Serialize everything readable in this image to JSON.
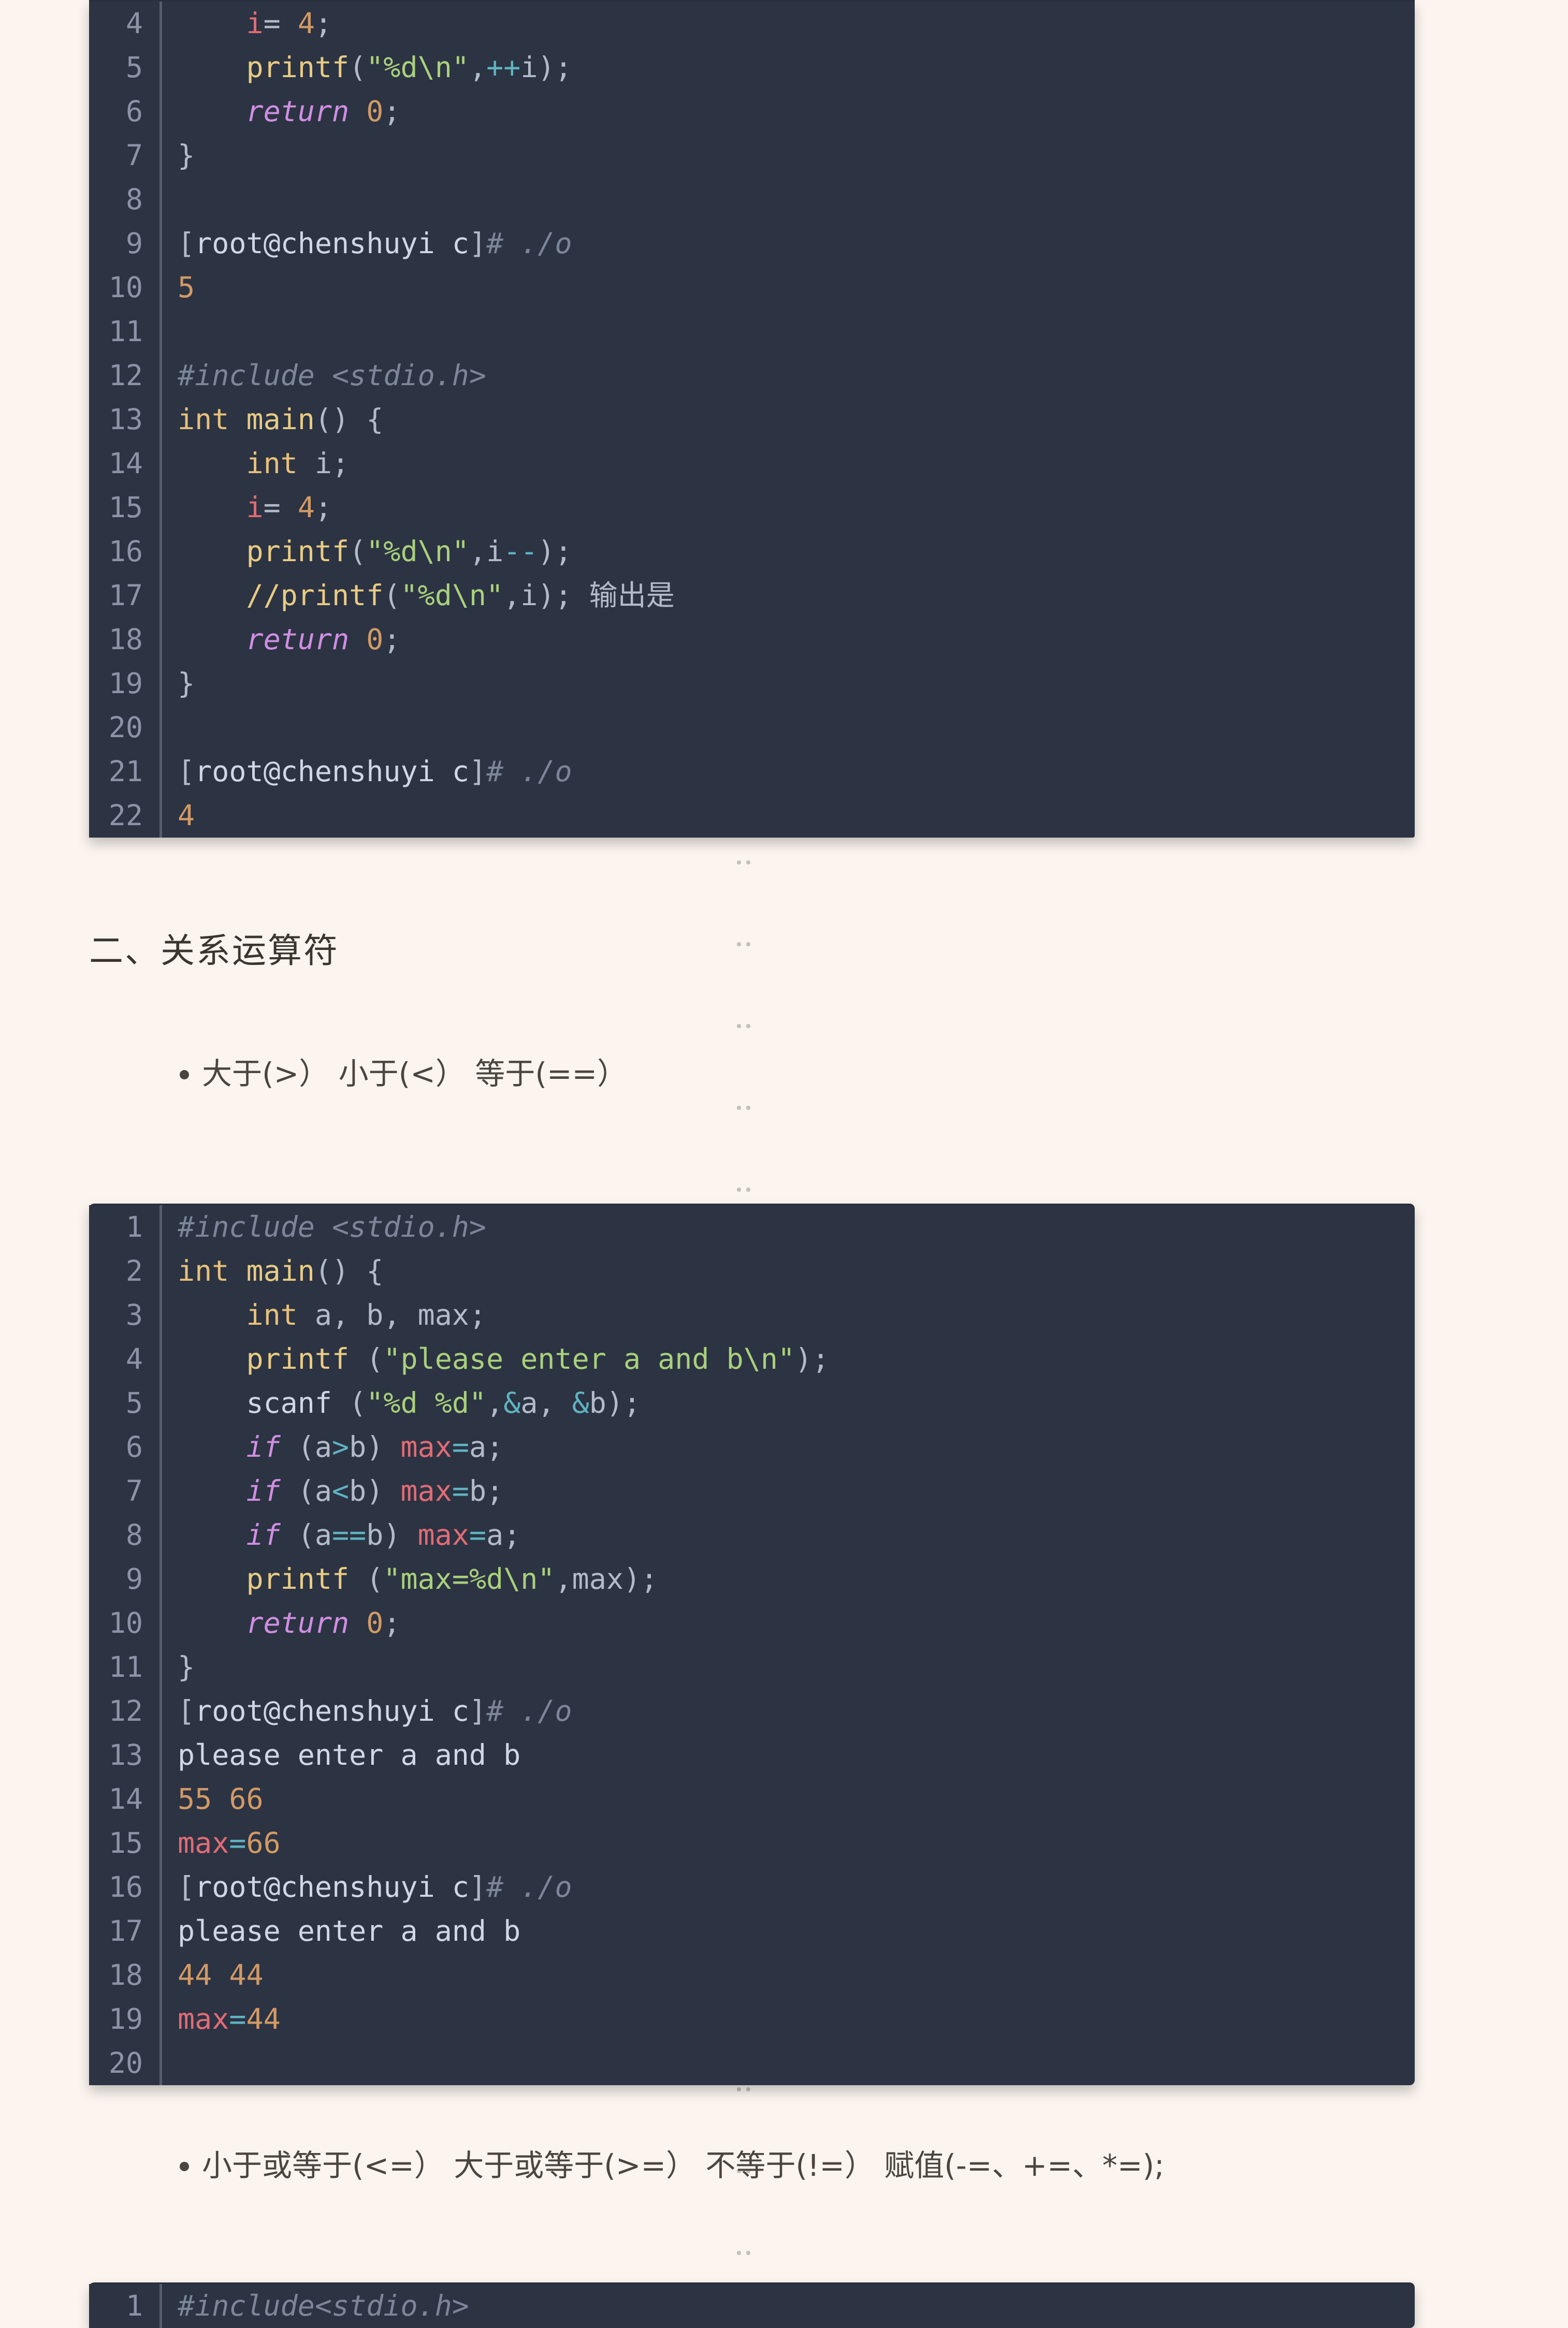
{
  "block1": {
    "lines": [
      {
        "n": "4",
        "tokens": [
          {
            "t": "    ",
            "c": "p"
          },
          {
            "t": "i",
            "c": "red"
          },
          {
            "t": "= ",
            "c": "p"
          },
          {
            "t": "4",
            "c": "num"
          },
          {
            "t": ";",
            "c": "p"
          }
        ]
      },
      {
        "n": "5",
        "tokens": [
          {
            "t": "    ",
            "c": "p"
          },
          {
            "t": "printf",
            "c": "fn"
          },
          {
            "t": "(",
            "c": "p"
          },
          {
            "t": "\"%d\\n\"",
            "c": "str"
          },
          {
            "t": ",",
            "c": "p"
          },
          {
            "t": "++",
            "c": "op"
          },
          {
            "t": "i);",
            "c": "p"
          }
        ]
      },
      {
        "n": "6",
        "tokens": [
          {
            "t": "    ",
            "c": "p"
          },
          {
            "t": "return",
            "c": "kw"
          },
          {
            "t": " ",
            "c": "p"
          },
          {
            "t": "0",
            "c": "num"
          },
          {
            "t": ";",
            "c": "p"
          }
        ]
      },
      {
        "n": "7",
        "tokens": [
          {
            "t": "}",
            "c": "p"
          }
        ]
      },
      {
        "n": "8",
        "tokens": [
          {
            "t": "",
            "c": "p"
          }
        ]
      },
      {
        "n": "9",
        "tokens": [
          {
            "t": "[",
            "c": "p"
          },
          {
            "t": "root@chenshuyi c",
            "c": "txt"
          },
          {
            "t": "]",
            "c": "p"
          },
          {
            "t": "# ./o",
            "c": "cmt"
          }
        ]
      },
      {
        "n": "10",
        "tokens": [
          {
            "t": "5",
            "c": "num"
          }
        ]
      },
      {
        "n": "11",
        "tokens": [
          {
            "t": "",
            "c": "p"
          }
        ]
      },
      {
        "n": "12",
        "tokens": [
          {
            "t": "#include <stdio.h>",
            "c": "cmt"
          }
        ]
      },
      {
        "n": "13",
        "tokens": [
          {
            "t": "int",
            "c": "ty"
          },
          {
            "t": " ",
            "c": "p"
          },
          {
            "t": "main",
            "c": "fn"
          },
          {
            "t": "() {",
            "c": "p"
          }
        ]
      },
      {
        "n": "14",
        "tokens": [
          {
            "t": "    ",
            "c": "p"
          },
          {
            "t": "int",
            "c": "ty"
          },
          {
            "t": " i;",
            "c": "p"
          }
        ]
      },
      {
        "n": "15",
        "tokens": [
          {
            "t": "    ",
            "c": "p"
          },
          {
            "t": "i",
            "c": "red"
          },
          {
            "t": "= ",
            "c": "p"
          },
          {
            "t": "4",
            "c": "num"
          },
          {
            "t": ";",
            "c": "p"
          }
        ]
      },
      {
        "n": "16",
        "tokens": [
          {
            "t": "    ",
            "c": "p"
          },
          {
            "t": "printf",
            "c": "fn"
          },
          {
            "t": "(",
            "c": "p"
          },
          {
            "t": "\"%d\\n\"",
            "c": "str"
          },
          {
            "t": ",i",
            "c": "p"
          },
          {
            "t": "--",
            "c": "op"
          },
          {
            "t": ");",
            "c": "p"
          }
        ]
      },
      {
        "n": "17",
        "tokens": [
          {
            "t": "    ",
            "c": "p"
          },
          {
            "t": "//printf",
            "c": "fn"
          },
          {
            "t": "(",
            "c": "p"
          },
          {
            "t": "\"%d\\n\"",
            "c": "str"
          },
          {
            "t": ",i); 输出是",
            "c": "p"
          }
        ]
      },
      {
        "n": "18",
        "tokens": [
          {
            "t": "    ",
            "c": "p"
          },
          {
            "t": "return",
            "c": "kw"
          },
          {
            "t": " ",
            "c": "p"
          },
          {
            "t": "0",
            "c": "num"
          },
          {
            "t": ";",
            "c": "p"
          }
        ]
      },
      {
        "n": "19",
        "tokens": [
          {
            "t": "}",
            "c": "p"
          }
        ]
      },
      {
        "n": "20",
        "tokens": [
          {
            "t": "",
            "c": "p"
          }
        ]
      },
      {
        "n": "21",
        "tokens": [
          {
            "t": "[",
            "c": "p"
          },
          {
            "t": "root@chenshuyi c",
            "c": "txt"
          },
          {
            "t": "]",
            "c": "p"
          },
          {
            "t": "# ./o",
            "c": "cmt"
          }
        ]
      },
      {
        "n": "22",
        "tokens": [
          {
            "t": "4",
            "c": "num"
          }
        ]
      }
    ]
  },
  "heading1": "二、关系运算符",
  "list1": [
    "大于(>） 小于(<） 等于(==）"
  ],
  "block2": {
    "lines": [
      {
        "n": "1",
        "tokens": [
          {
            "t": "#include <stdio.h>",
            "c": "cmt"
          }
        ]
      },
      {
        "n": "2",
        "tokens": [
          {
            "t": "int",
            "c": "ty"
          },
          {
            "t": " ",
            "c": "p"
          },
          {
            "t": "main",
            "c": "fn"
          },
          {
            "t": "() {",
            "c": "p"
          }
        ]
      },
      {
        "n": "3",
        "tokens": [
          {
            "t": "    ",
            "c": "p"
          },
          {
            "t": "int",
            "c": "ty"
          },
          {
            "t": " a, b, max;",
            "c": "p"
          }
        ]
      },
      {
        "n": "4",
        "tokens": [
          {
            "t": "    ",
            "c": "p"
          },
          {
            "t": "printf",
            "c": "fn"
          },
          {
            "t": " (",
            "c": "p"
          },
          {
            "t": "\"please enter a and b\\n\"",
            "c": "str"
          },
          {
            "t": ");",
            "c": "p"
          }
        ]
      },
      {
        "n": "5",
        "tokens": [
          {
            "t": "    ",
            "c": "p"
          },
          {
            "t": "scanf",
            "c": "txt"
          },
          {
            "t": " (",
            "c": "p"
          },
          {
            "t": "\"%d %d\"",
            "c": "str"
          },
          {
            "t": ",",
            "c": "p"
          },
          {
            "t": "&",
            "c": "op"
          },
          {
            "t": "a, ",
            "c": "p"
          },
          {
            "t": "&",
            "c": "op"
          },
          {
            "t": "b);",
            "c": "p"
          }
        ]
      },
      {
        "n": "6",
        "tokens": [
          {
            "t": "    ",
            "c": "p"
          },
          {
            "t": "if",
            "c": "kw"
          },
          {
            "t": " (a",
            "c": "p"
          },
          {
            "t": ">",
            "c": "op"
          },
          {
            "t": "b) ",
            "c": "p"
          },
          {
            "t": "max",
            "c": "red"
          },
          {
            "t": "=",
            "c": "op"
          },
          {
            "t": "a;",
            "c": "p"
          }
        ]
      },
      {
        "n": "7",
        "tokens": [
          {
            "t": "    ",
            "c": "p"
          },
          {
            "t": "if",
            "c": "kw"
          },
          {
            "t": " (a",
            "c": "p"
          },
          {
            "t": "<",
            "c": "op"
          },
          {
            "t": "b) ",
            "c": "p"
          },
          {
            "t": "max",
            "c": "red"
          },
          {
            "t": "=",
            "c": "op"
          },
          {
            "t": "b;",
            "c": "p"
          }
        ]
      },
      {
        "n": "8",
        "tokens": [
          {
            "t": "    ",
            "c": "p"
          },
          {
            "t": "if",
            "c": "kw"
          },
          {
            "t": " (a",
            "c": "p"
          },
          {
            "t": "==",
            "c": "op"
          },
          {
            "t": "b) ",
            "c": "p"
          },
          {
            "t": "max",
            "c": "red"
          },
          {
            "t": "=",
            "c": "op"
          },
          {
            "t": "a;",
            "c": "p"
          }
        ]
      },
      {
        "n": "9",
        "tokens": [
          {
            "t": "    ",
            "c": "p"
          },
          {
            "t": "printf",
            "c": "fn"
          },
          {
            "t": " (",
            "c": "p"
          },
          {
            "t": "\"max=%d\\n\"",
            "c": "str"
          },
          {
            "t": ",max);",
            "c": "p"
          }
        ]
      },
      {
        "n": "10",
        "tokens": [
          {
            "t": "    ",
            "c": "p"
          },
          {
            "t": "return",
            "c": "kw"
          },
          {
            "t": " ",
            "c": "p"
          },
          {
            "t": "0",
            "c": "num"
          },
          {
            "t": ";",
            "c": "p"
          }
        ]
      },
      {
        "n": "11",
        "tokens": [
          {
            "t": "}",
            "c": "p"
          }
        ]
      },
      {
        "n": "12",
        "tokens": [
          {
            "t": "[",
            "c": "p"
          },
          {
            "t": "root@chenshuyi c",
            "c": "txt"
          },
          {
            "t": "]",
            "c": "p"
          },
          {
            "t": "# ./o",
            "c": "cmt"
          }
        ]
      },
      {
        "n": "13",
        "tokens": [
          {
            "t": "please enter a and b",
            "c": "txt"
          }
        ]
      },
      {
        "n": "14",
        "tokens": [
          {
            "t": "55",
            "c": "num"
          },
          {
            "t": " ",
            "c": "p"
          },
          {
            "t": "66",
            "c": "num"
          }
        ]
      },
      {
        "n": "15",
        "tokens": [
          {
            "t": "max",
            "c": "red"
          },
          {
            "t": "=",
            "c": "op"
          },
          {
            "t": "66",
            "c": "num"
          }
        ]
      },
      {
        "n": "16",
        "tokens": [
          {
            "t": "[",
            "c": "p"
          },
          {
            "t": "root@chenshuyi c",
            "c": "txt"
          },
          {
            "t": "]",
            "c": "p"
          },
          {
            "t": "# ./o",
            "c": "cmt"
          }
        ]
      },
      {
        "n": "17",
        "tokens": [
          {
            "t": "please enter a and b",
            "c": "txt"
          }
        ]
      },
      {
        "n": "18",
        "tokens": [
          {
            "t": "44",
            "c": "num"
          },
          {
            "t": " ",
            "c": "p"
          },
          {
            "t": "44",
            "c": "num"
          }
        ]
      },
      {
        "n": "19",
        "tokens": [
          {
            "t": "max",
            "c": "red"
          },
          {
            "t": "=",
            "c": "op"
          },
          {
            "t": "44",
            "c": "num"
          }
        ]
      },
      {
        "n": "20",
        "tokens": [
          {
            "t": "",
            "c": "p"
          }
        ]
      }
    ]
  },
  "list2": [
    "小于或等于(<=） 大于或等于(>=） 不等于(!=） 赋值(-=、+=、*=);"
  ],
  "block3": {
    "lines": [
      {
        "n": "1",
        "tokens": [
          {
            "t": "#include<stdio.h>",
            "c": "cmt"
          }
        ]
      }
    ]
  }
}
